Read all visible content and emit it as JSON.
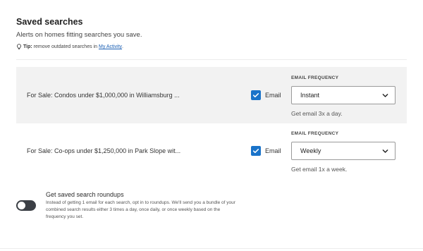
{
  "section": {
    "title": "Saved searches",
    "subtitle": "Alerts on homes fitting searches you save.",
    "tip_bold": "Tip:",
    "tip_text": "remove outdated searches in",
    "tip_link": "My Activity",
    "tip_end": "."
  },
  "searches": [
    {
      "label": "For Sale: Condos under $1,000,000 in Williamsburg ...",
      "email_checked": true,
      "email_label": "Email",
      "frequency_label": "EMAIL FREQUENCY",
      "frequency_value": "Instant",
      "hint": "Get email 3x a day."
    },
    {
      "label": "For Sale: Co-ops under $1,250,000 in Park Slope wit...",
      "email_checked": true,
      "email_label": "Email",
      "frequency_label": "EMAIL FREQUENCY",
      "frequency_value": "Weekly",
      "hint": "Get email 1x a week."
    }
  ],
  "roundup": {
    "title": "Get saved search roundups",
    "description": "Instead of getting 1 email for each search, opt in to roundups. We'll send you a bundle of your combined search results either 3 times a day, once daily, or once weekly based on the frequency you set.",
    "enabled": false
  },
  "colors": {
    "accent": "#1a73c9",
    "link": "#1a5fb4",
    "toggle_off": "#3b3f45",
    "row_highlight": "#f2f2f2"
  },
  "icons": {
    "tip": "lightbulb-icon",
    "checkbox": "checkmark-icon",
    "select": "chevron-down-icon"
  }
}
